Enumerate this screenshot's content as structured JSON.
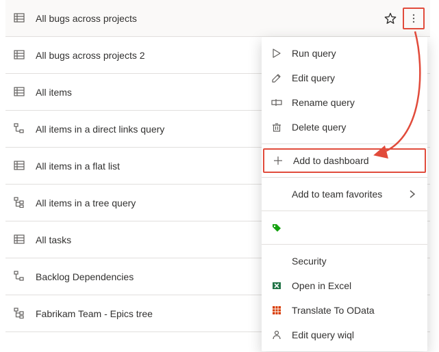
{
  "queries": [
    {
      "label": "All bugs across projects",
      "iconType": "flat",
      "selected": true,
      "showStar": true,
      "showMore": true
    },
    {
      "label": "All bugs across projects 2",
      "iconType": "flat"
    },
    {
      "label": "All items",
      "iconType": "flat"
    },
    {
      "label": "All items in a direct links query",
      "iconType": "links"
    },
    {
      "label": "All items in a flat list",
      "iconType": "flat"
    },
    {
      "label": "All items in a tree query",
      "iconType": "tree"
    },
    {
      "label": "All tasks",
      "iconType": "flat"
    },
    {
      "label": "Backlog Dependencies",
      "iconType": "links"
    },
    {
      "label": "Fabrikam Team - Epics tree",
      "iconType": "tree"
    }
  ],
  "menu": {
    "run": "Run query",
    "edit": "Edit query",
    "rename": "Rename query",
    "delete": "Delete query",
    "addDash": "Add to dashboard",
    "addFav": "Add to team favorites",
    "security": "Security",
    "excel": "Open in Excel",
    "odata": "Translate To OData",
    "wiql": "Edit query wiql"
  }
}
